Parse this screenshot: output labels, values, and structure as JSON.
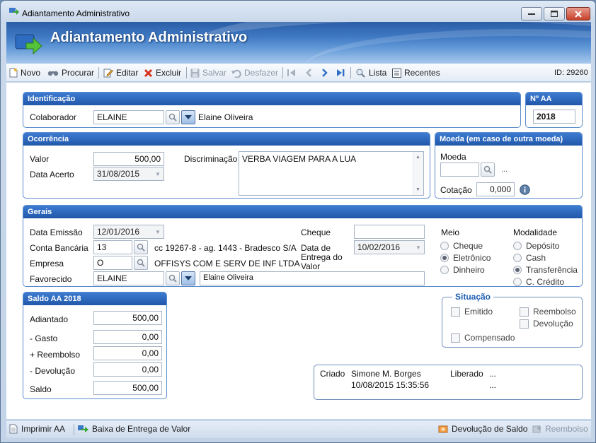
{
  "window": {
    "title": "Adiantamento Administrativo"
  },
  "banner": {
    "title": "Adiantamento Administrativo"
  },
  "toolbar": {
    "novo": "Novo",
    "procurar": "Procurar",
    "editar": "Editar",
    "excluir": "Excluir",
    "salvar": "Salvar",
    "desfazer": "Desfazer",
    "lista": "Lista",
    "recentes": "Recentes",
    "id": "ID: 29260"
  },
  "identificacao": {
    "header": "Identificação",
    "colaborador_label": "Colaborador",
    "colaborador_value": "ELAINE",
    "colaborador_name": "Elaine Oliveira"
  },
  "nro_aa": {
    "header": "Nº AA",
    "value": "2018"
  },
  "ocorrencia": {
    "header": "Ocorrência",
    "valor_label": "Valor",
    "valor_value": "500,00",
    "data_acerto_label": "Data Acerto",
    "data_acerto_value": "31/08/2015",
    "discriminacao_label": "Discriminação",
    "discriminacao_value": "VERBA VIAGEM PARA A LUA"
  },
  "moeda": {
    "header": "Moeda (em caso de outra moeda)",
    "moeda_label": "Moeda",
    "moeda_value": "",
    "moeda_desc": "...",
    "cotacao_label": "Cotação",
    "cotacao_value": "0,000"
  },
  "gerais": {
    "header": "Gerais",
    "data_emissao_label": "Data Emissão",
    "data_emissao_value": "12/01/2016",
    "conta_label": "Conta Bancária",
    "conta_value": "13",
    "conta_desc": "cc 19267-8 - ag. 1443  - Bradesco S/A",
    "empresa_label": "Empresa",
    "empresa_value": "O",
    "empresa_desc": "OFFISYS COM E SERV DE INF LTDA",
    "favorecido_label": "Favorecido",
    "favorecido_value": "ELAINE",
    "favorecido_name": "Elaine Oliveira",
    "cheque_label": "Cheque",
    "cheque_value": "",
    "data_entrega_label_1": "Data de",
    "data_entrega_label_2": "Entrega do",
    "data_entrega_label_3": "Valor",
    "data_entrega_value": "10/02/2016",
    "meio_label": "Meio",
    "meio_options": [
      "Cheque",
      "Eletrônico",
      "Dinheiro"
    ],
    "meio_selected": 1,
    "modalidade_label": "Modalidade",
    "modalidade_options": [
      "Depósito",
      "Cash",
      "Transferência",
      "C. Crédito"
    ],
    "modalidade_selected": 2
  },
  "saldo": {
    "header": "Saldo AA 2018",
    "adiantado_label": "Adiantado",
    "adiantado_value": "500,00",
    "gasto_label": "- Gasto",
    "gasto_value": "0,00",
    "reembolso_label": "+ Reembolso",
    "reembolso_value": "0,00",
    "devolucao_label": "- Devolução",
    "devolucao_value": "0,00",
    "saldo_label": "Saldo",
    "saldo_value": "500,00"
  },
  "situacao": {
    "header": "Situação",
    "emitido": "Emitido",
    "reembolso": "Reembolso",
    "devolucao": "Devolução",
    "compensado": "Compensado"
  },
  "audit": {
    "criado_label": "Criado",
    "criado_user": "Simone M. Borges",
    "criado_date": "10/08/2015 15:35:56",
    "liberado_label": "Liberado",
    "liberado_user": "...",
    "liberado_date": "..."
  },
  "bottom": {
    "imprimir": "Imprimir AA",
    "baixa": "Baixa de Entrega de Valor",
    "devolucao_saldo": "Devolução de Saldo",
    "reembolso": "Reembolso"
  },
  "colors": {
    "header_blue": "#2157a9",
    "banner_blue": "#3f79c3",
    "accent_green": "#3aa33a"
  }
}
